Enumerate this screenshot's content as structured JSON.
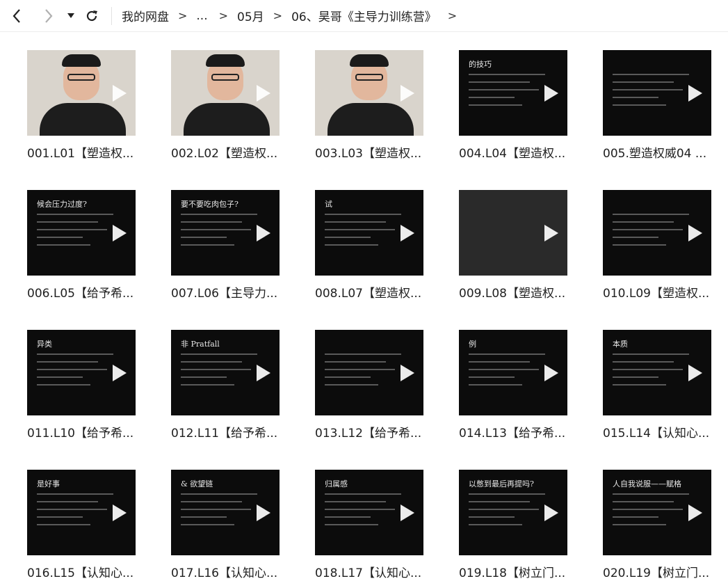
{
  "toolbar": {
    "back_icon": "chevron-left-icon",
    "forward_icon": "chevron-right-icon",
    "dropdown_icon": "caret-down-icon",
    "refresh_icon": "refresh-icon"
  },
  "breadcrumb": {
    "items": [
      "我的网盘",
      "...",
      "05月",
      "06、昊哥《主导力训练营》"
    ],
    "separator": ">",
    "trailing": ">"
  },
  "files": [
    {
      "name": "001.L01【塑造权...",
      "thumb": "face",
      "thumb_title": ""
    },
    {
      "name": "002.L02【塑造权...",
      "thumb": "face",
      "thumb_title": ""
    },
    {
      "name": "003.L03【塑造权...",
      "thumb": "face",
      "thumb_title": ""
    },
    {
      "name": "004.L04【塑造权...",
      "thumb": "slide",
      "thumb_title": "的技巧"
    },
    {
      "name": "005.塑造权威04 ...",
      "thumb": "slide",
      "thumb_title": ""
    },
    {
      "name": "006.L05【给予希...",
      "thumb": "slide",
      "thumb_title": "候会压力过度?"
    },
    {
      "name": "007.L06【主导力...",
      "thumb": "slide",
      "thumb_title": "要不要吃肉包子?"
    },
    {
      "name": "008.L07【塑造权...",
      "thumb": "slide",
      "thumb_title": "试"
    },
    {
      "name": "009.L08【塑造权...",
      "thumb": "empty",
      "thumb_title": ""
    },
    {
      "name": "010.L09【塑造权...",
      "thumb": "slide",
      "thumb_title": ""
    },
    {
      "name": "011.L10【给予希...",
      "thumb": "slide",
      "thumb_title": "异类"
    },
    {
      "name": "012.L11【给予希...",
      "thumb": "slide",
      "thumb_title": "非 Pratfall"
    },
    {
      "name": "013.L12【给予希...",
      "thumb": "slide",
      "thumb_title": ""
    },
    {
      "name": "014.L13【给予希...",
      "thumb": "slide",
      "thumb_title": "例"
    },
    {
      "name": "015.L14【认知心...",
      "thumb": "slide",
      "thumb_title": "本质"
    },
    {
      "name": "016.L15【认知心...",
      "thumb": "slide",
      "thumb_title": "是好事"
    },
    {
      "name": "017.L16【认知心...",
      "thumb": "slide",
      "thumb_title": "& 欲望链"
    },
    {
      "name": "018.L17【认知心...",
      "thumb": "slide",
      "thumb_title": "归属感"
    },
    {
      "name": "019.L18【树立门...",
      "thumb": "slide",
      "thumb_title": "以憋到最后再提吗?"
    },
    {
      "name": "020.L19【树立门...",
      "thumb": "slide",
      "thumb_title": "人自我说服——赋格"
    }
  ]
}
